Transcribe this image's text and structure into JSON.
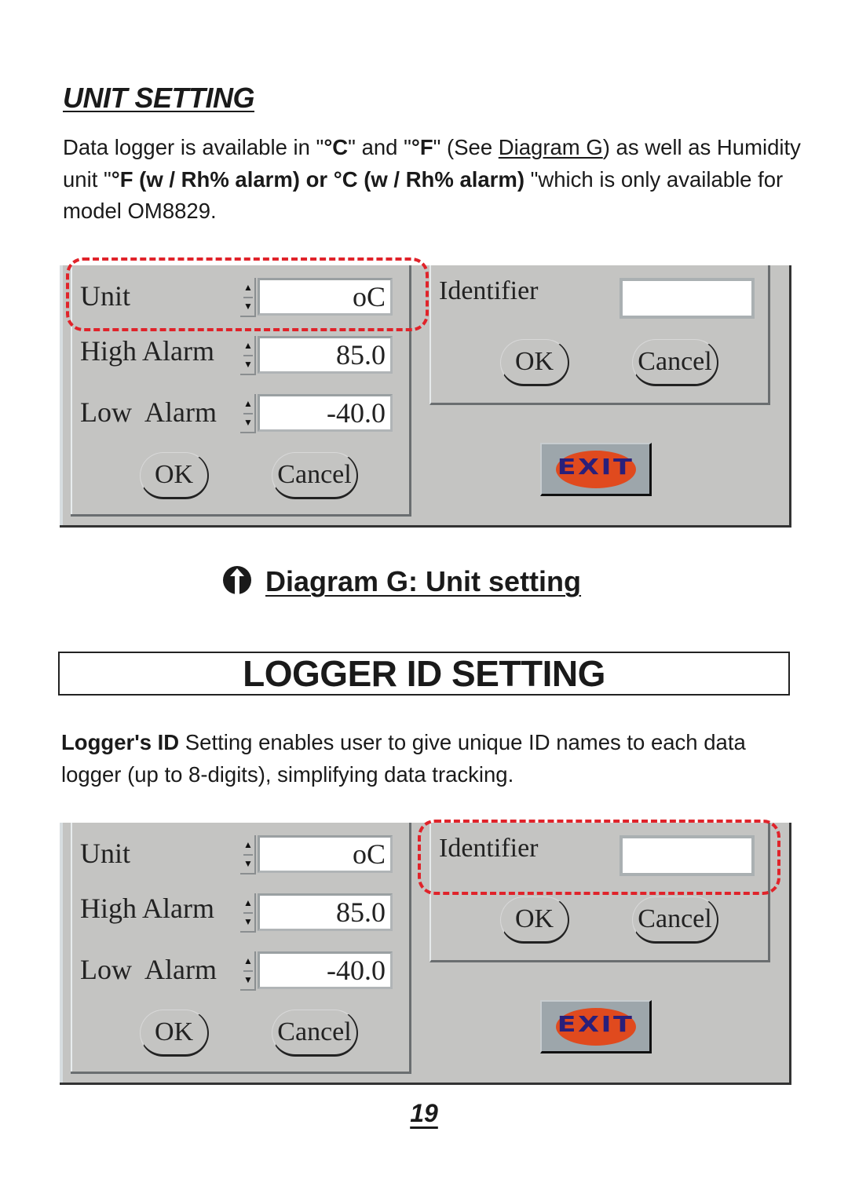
{
  "unit_section": {
    "title": "UNIT SETTING",
    "para_parts": {
      "a": "Data logger is available in \"",
      "c_unit": "°C",
      "b": "\" and \"",
      "f_unit": "°F",
      "c": "\" (See ",
      "link": "Diagram G",
      "d": ") as well as Humidity unit \"",
      "bold2": "°F (w / Rh%  alarm) or °C (w / Rh% alarm)",
      "e": " \"which is only available for model OM8829."
    }
  },
  "dialog_labels": {
    "unit": "Unit",
    "high_alarm": "High Alarm",
    "low_alarm": "Low  Alarm",
    "ok": "OK",
    "cancel": "Cancel",
    "identifier": "Identifier",
    "exit": "EXIT",
    "spin_up": "▲",
    "spin_down": "▼"
  },
  "diagram_g": {
    "unit_value": "oC",
    "high_alarm_value": "85.0",
    "low_alarm_value": "-40.0",
    "identifier_value": "",
    "highlight": "unit"
  },
  "caption": {
    "icon": "arrow-up-circle-icon",
    "text": "Diagram G: Unit setting"
  },
  "logger_section": {
    "title": "LOGGER ID SETTING",
    "bold_lead": "Logger's ID",
    "rest": " Setting enables user to give unique ID names to each data logger (up to 8-digits), simplifying data tracking."
  },
  "diagram_h": {
    "unit_value": "oC",
    "high_alarm_value": "85.0",
    "low_alarm_value": "-40.0",
    "identifier_value": "",
    "highlight": "identifier"
  },
  "colors": {
    "highlight_dash": "#e0232a",
    "panel_bg": "#c4c4c2",
    "exit_oval": "#e04a1e",
    "exit_text": "#2a1f7a"
  },
  "page_number": "19"
}
